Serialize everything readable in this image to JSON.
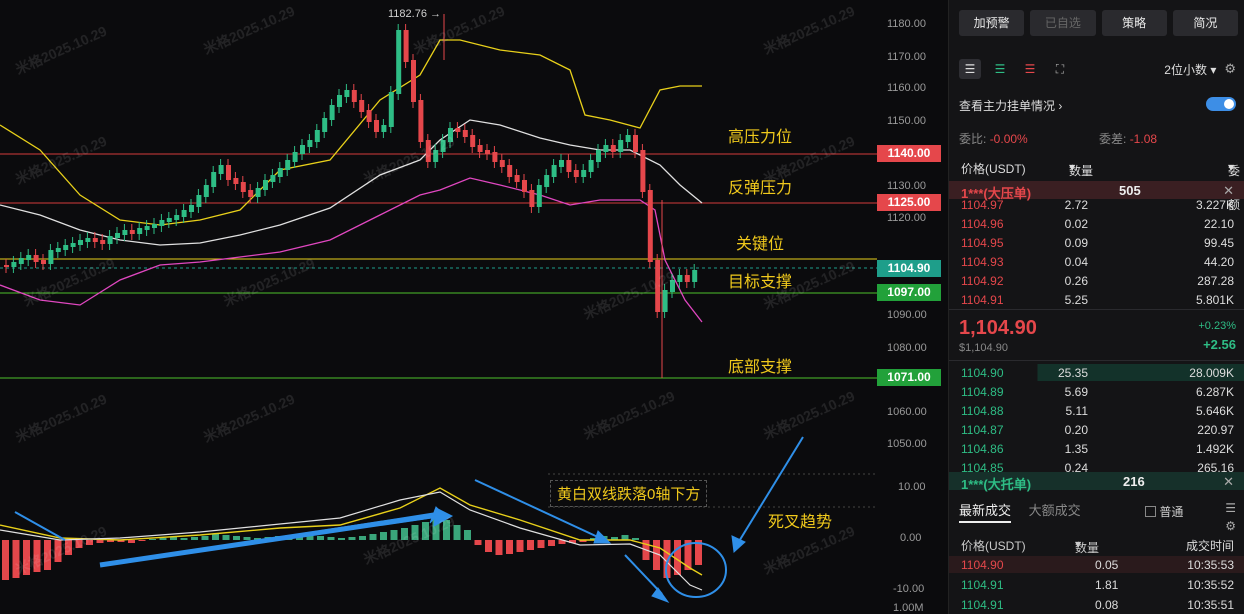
{
  "chart": {
    "watermark": "米格2025.10.29",
    "peak_label": "1182.76",
    "axis_ticks": [
      "1180.00",
      "1170.00",
      "1160.00",
      "1150.00",
      "1130.00",
      "1120.00",
      "1090.00",
      "1080.00",
      "1060.00",
      "1050.00"
    ],
    "macd_ticks": [
      "10.00",
      "0.00",
      "-10.00"
    ],
    "volume_tick": "1.00M",
    "price_tags": [
      {
        "value": "1140.00",
        "color": "#e5474b"
      },
      {
        "value": "1125.00",
        "color": "#e5474b"
      },
      {
        "value": "1104.90",
        "color": "#1e9e8a"
      },
      {
        "value": "1097.00",
        "color": "#22a13a"
      },
      {
        "value": "1071.00",
        "color": "#22a13a"
      }
    ],
    "annotations": {
      "high_resistance": "高压力位",
      "rebound_resistance": "反弹压力",
      "key_level": "关键位",
      "target_support": "目标支撑",
      "bottom_support": "底部支撑",
      "macd_note": "黄白双线跌落0轴下方",
      "death_cross": "死叉趋势"
    }
  },
  "panel": {
    "buttons": [
      "加预警",
      "已自选",
      "策略",
      "简况"
    ],
    "decimals": "2位小数",
    "view_orders": "查看主力挂单情况",
    "ratio_label": "委比:",
    "ratio_value": "-0.00%",
    "diff_label": "委差:",
    "diff_value": "-1.08",
    "col_price": "价格(USDT)",
    "col_qty": "数量 (BNB)",
    "col_total": "委托额",
    "ask_banner": {
      "label": "1***(大压单)",
      "qty": "505"
    },
    "asks": [
      {
        "price": "1104.97",
        "qty": "2.72",
        "total": "3.227K"
      },
      {
        "price": "1104.96",
        "qty": "0.02",
        "total": "22.10"
      },
      {
        "price": "1104.95",
        "qty": "0.09",
        "total": "99.45"
      },
      {
        "price": "1104.93",
        "qty": "0.04",
        "total": "44.20"
      },
      {
        "price": "1104.92",
        "qty": "0.26",
        "total": "287.28"
      },
      {
        "price": "1104.91",
        "qty": "5.25",
        "total": "5.801K"
      }
    ],
    "last_price": "1,104.90",
    "last_price_sub": "$1,104.90",
    "change_pct": "+0.23%",
    "change_abs": "+2.56",
    "bids": [
      {
        "price": "1104.90",
        "qty": "25.35",
        "total": "28.009K"
      },
      {
        "price": "1104.89",
        "qty": "5.69",
        "total": "6.287K"
      },
      {
        "price": "1104.88",
        "qty": "5.11",
        "total": "5.646K"
      },
      {
        "price": "1104.87",
        "qty": "0.20",
        "total": "220.97"
      },
      {
        "price": "1104.86",
        "qty": "1.35",
        "total": "1.492K"
      },
      {
        "price": "1104.85",
        "qty": "0.24",
        "total": "265.16"
      }
    ],
    "bid_banner": {
      "label": "1***(大托单)",
      "qty": "216"
    },
    "tabs": {
      "latest": "最新成交",
      "large": "大额成交",
      "normal": "普通"
    },
    "trade_cols": {
      "price": "价格(USDT)",
      "qty": "数量(BNB)",
      "time": "成交时间"
    },
    "trades": [
      {
        "price": "1104.90",
        "qty": "0.05",
        "time": "10:35:53",
        "side": "sell"
      },
      {
        "price": "1104.91",
        "qty": "1.81",
        "time": "10:35:52",
        "side": "buy"
      },
      {
        "price": "1104.91",
        "qty": "0.08",
        "time": "10:35:51",
        "side": "buy"
      }
    ]
  }
}
